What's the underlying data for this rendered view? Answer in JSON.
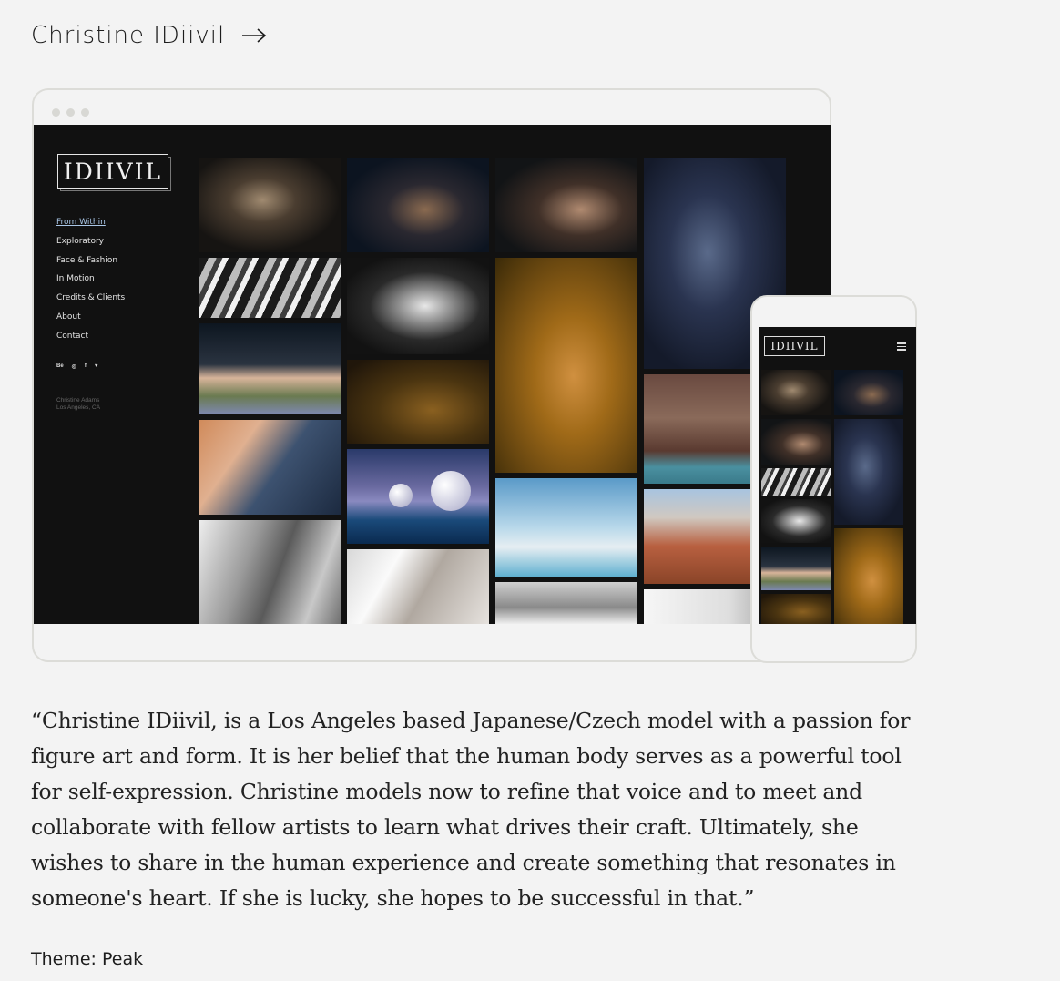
{
  "header": {
    "site_name": "Christine IDiivil"
  },
  "mockup": {
    "logo_text": "IDIIVIL",
    "nav_items": [
      {
        "label": "From Within",
        "active": true
      },
      {
        "label": "Exploratory"
      },
      {
        "label": "Face & Fashion"
      },
      {
        "label": "In Motion"
      },
      {
        "label": "Credits & Clients"
      },
      {
        "label": "About"
      },
      {
        "label": "Contact"
      }
    ],
    "social": [
      "Bē",
      "◎",
      "f",
      "♥"
    ],
    "footer_name": "Christine Adams",
    "footer_location": "Los Angeles, CA",
    "phone_logo_text": "IDIIVIL"
  },
  "description": "“Christine IDiivil, is a Los Angeles based Japanese/Czech model with a passion for figure art and form. It is her belief that the human body serves as a powerful tool for self-expression. Christine models now to refine that voice and to meet and collaborate with fellow artists to learn what drives their craft. Ultimately, she wishes to share in the human experience and create something that resonates in someone's heart. If she is lucky, she hopes to be successful in that.”",
  "theme": {
    "text": "Theme: Peak"
  }
}
